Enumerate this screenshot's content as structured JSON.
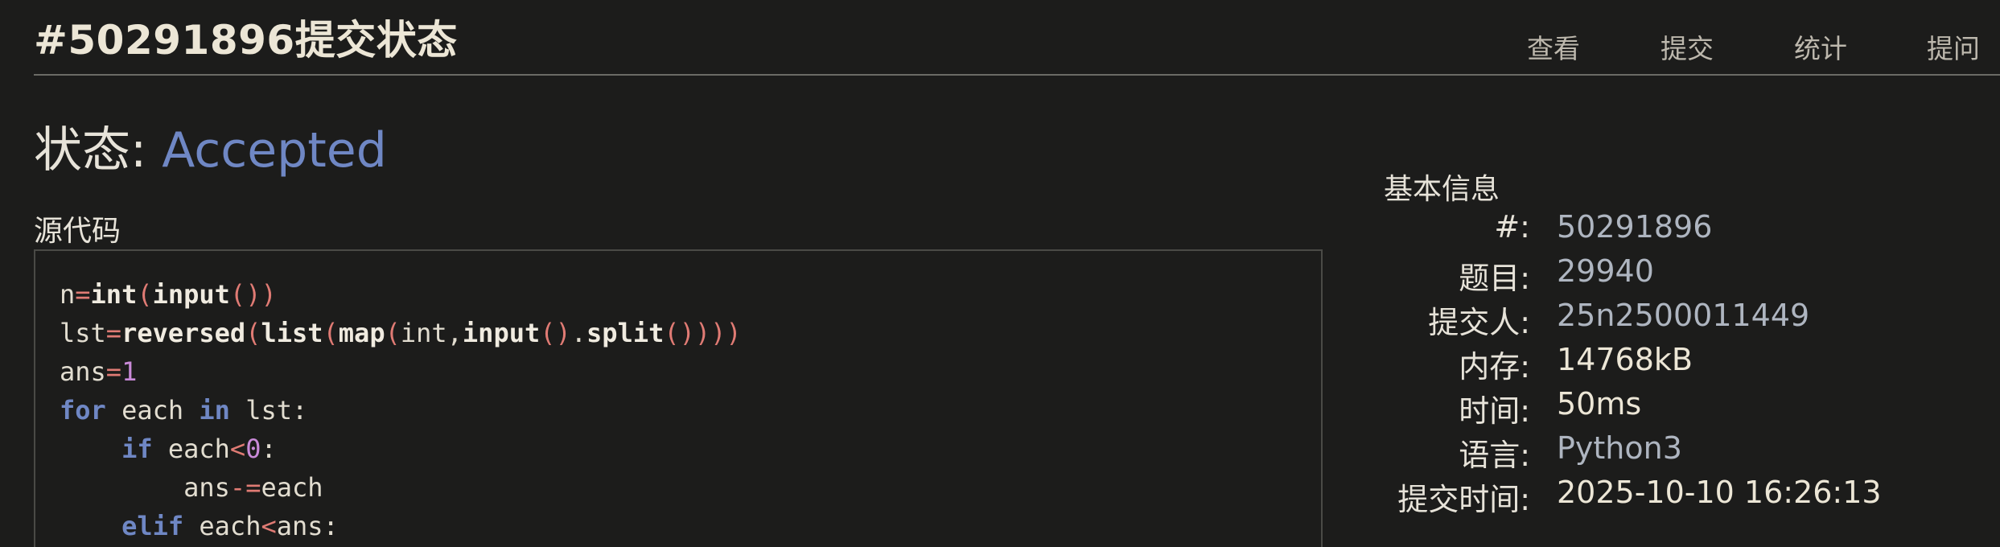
{
  "header": {
    "title": "#50291896提交状态",
    "nav": [
      "查看",
      "提交",
      "统计",
      "提问"
    ]
  },
  "status": {
    "label": "状态: ",
    "value": "Accepted"
  },
  "source": {
    "label": "源代码",
    "lines": [
      "n=int(input())",
      "lst=reversed(list(map(int,input().split())))",
      "ans=1",
      "for each in lst:",
      "    if each<0:",
      "        ans-=each",
      "    elif each<ans:"
    ]
  },
  "info": {
    "title": "基本信息",
    "rows": [
      {
        "label": "#:",
        "value": "50291896"
      },
      {
        "label": "题目:",
        "value": "29940"
      },
      {
        "label": "提交人:",
        "value": "25n2500011449"
      },
      {
        "label": "内存:",
        "value": "14768kB"
      },
      {
        "label": "时间:",
        "value": "50ms"
      },
      {
        "label": "语言:",
        "value": "Python3"
      },
      {
        "label": "提交时间:",
        "value": "2025-10-10 16:26:13"
      }
    ]
  },
  "colors": {
    "background": "#1c1c1b",
    "accepted": "#6f87c4",
    "keyword": "#6f87c4",
    "operator": "#e07b74",
    "number": "#c98ad8"
  }
}
